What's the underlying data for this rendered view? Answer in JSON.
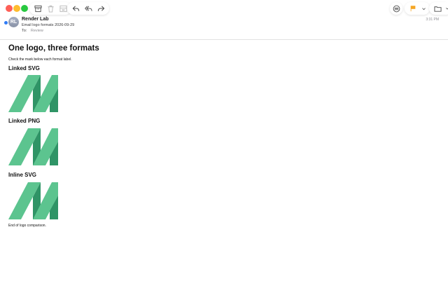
{
  "message": {
    "sender": "Render Lab",
    "initials": "RL",
    "subject": "Email logo formats 2026-09-29",
    "to_label": "To:",
    "to_value": "Review",
    "time": "3:31 PM"
  },
  "body": {
    "title": "One logo, three formats",
    "intro": "Check the mark below each format label.",
    "sections": [
      {
        "label": "Linked SVG"
      },
      {
        "label": "Linked PNG"
      },
      {
        "label": "Inline SVG"
      }
    ],
    "closing": "End of logo comparison."
  },
  "colors": {
    "logo_light": "#5cc48f",
    "logo_dark": "#2f9466",
    "flag": "#f5a623"
  }
}
